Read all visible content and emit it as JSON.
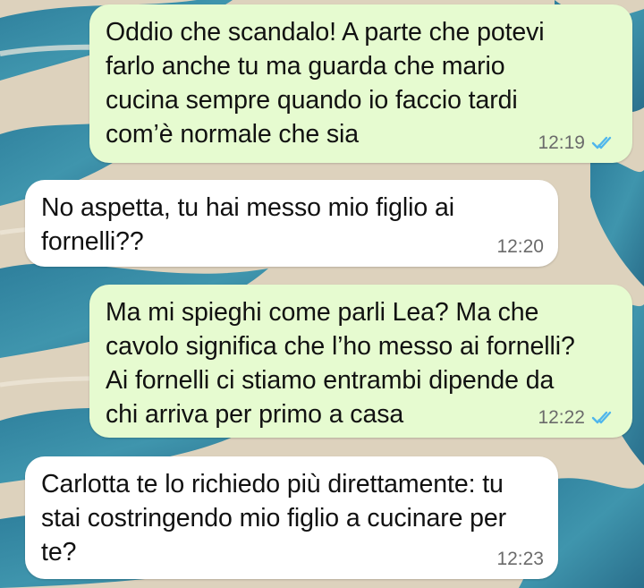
{
  "messages": [
    {
      "direction": "outgoing",
      "text": "Oddio che scandalo! A parte che potevi\nfarlo anche tu ma guarda che mario\ncucina sempre quando io faccio tardi\ncom’è normale che sia",
      "time": "12:19",
      "status_icon": "read-double-check-icon"
    },
    {
      "direction": "incoming",
      "text": "No aspetta, tu hai messo mio figlio ai\nfornelli??",
      "time": "12:20"
    },
    {
      "direction": "outgoing",
      "text": "Ma mi spieghi come parli Lea? Ma che\ncavolo significa che l’ho messo ai fornelli?\nAi fornelli ci stiamo entrambi dipende da\nchi arriva per primo a casa",
      "time": "12:22",
      "status_icon": "read-double-check-icon"
    },
    {
      "direction": "incoming",
      "text": "Carlotta te lo richiedo più direttamente: tu\nstai costringendo mio figlio a cucinare per\nte?",
      "time": "12:23"
    }
  ],
  "colors": {
    "outgoing_bubble": "#e6fbd0",
    "incoming_bubble": "#ffffff",
    "read_ticks": "#4fb6ec",
    "timestamp": "#6b6b6b"
  }
}
